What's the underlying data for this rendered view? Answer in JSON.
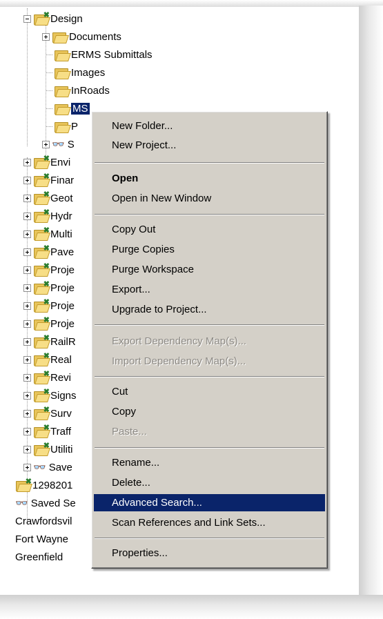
{
  "tree": {
    "design_label": "Design",
    "design_children": [
      "Documents",
      "ERMS Submittals",
      "Images",
      "InRoads",
      "MS",
      "P",
      "S"
    ],
    "siblings": [
      "Envi",
      "Finar",
      "Geot",
      "Hydr",
      "Multi",
      "Pave",
      "Proje",
      "Proje",
      "Proje",
      "Proje",
      "RailR",
      "Real",
      "Revi",
      "Signs",
      "Surv",
      "Traff",
      "Utiliti"
    ],
    "saved_child": "Save",
    "root_items": [
      "1298201",
      "Saved Se"
    ],
    "offices": [
      "Crawfordsvil",
      "Fort Wayne",
      "Greenfield"
    ]
  },
  "menu": {
    "items": [
      {
        "label": "New Folder...",
        "style": "normal"
      },
      {
        "label": "New Project...",
        "style": "normal"
      },
      {
        "label": "Open",
        "style": "bold"
      },
      {
        "label": "Open in New Window",
        "style": "normal"
      },
      {
        "label": "Copy Out",
        "style": "normal"
      },
      {
        "label": "Purge Copies",
        "style": "normal"
      },
      {
        "label": "Purge Workspace",
        "style": "normal"
      },
      {
        "label": "Export...",
        "style": "normal"
      },
      {
        "label": "Upgrade to Project...",
        "style": "normal"
      },
      {
        "label": "Export Dependency Map(s)...",
        "style": "disabled"
      },
      {
        "label": "Import Dependency Map(s)...",
        "style": "disabled"
      },
      {
        "label": "Cut",
        "style": "normal"
      },
      {
        "label": "Copy",
        "style": "normal"
      },
      {
        "label": "Paste...",
        "style": "disabled"
      },
      {
        "label": "Rename...",
        "style": "normal"
      },
      {
        "label": "Delete...",
        "style": "normal"
      },
      {
        "label": "Advanced Search...",
        "style": "highlighted"
      },
      {
        "label": "Scan References and Link Sets...",
        "style": "normal"
      },
      {
        "label": "Properties...",
        "style": "normal"
      }
    ]
  },
  "colors": {
    "menu_bg": "#d4d0c8",
    "highlight": "#0a246a",
    "disabled_text": "#8d8a85"
  }
}
